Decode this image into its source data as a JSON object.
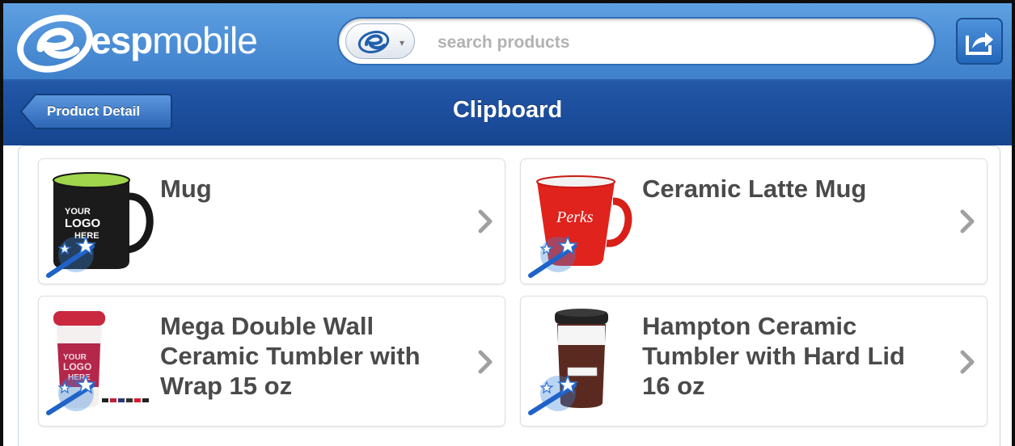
{
  "header": {
    "logo_text_bold": "esp",
    "logo_text_light": "mobile",
    "search": {
      "placeholder": "search products",
      "value": ""
    }
  },
  "subheader": {
    "back_label": "Product Detail",
    "title": "Clipboard"
  },
  "products": [
    {
      "name": "Mug",
      "image": "black-mug-with-green-interior"
    },
    {
      "name": "Ceramic Latte Mug",
      "image": "red-latte-mug"
    },
    {
      "name": "Mega Double Wall Ceramic Tumbler with Wrap 15 oz",
      "image": "red-ceramic-tumbler-with-wrap"
    },
    {
      "name": "Hampton Ceramic Tumbler with Hard Lid 16 oz",
      "image": "brown-ceramic-tumbler-with-black-lid"
    }
  ],
  "thumbnail_texts": {
    "mug_imprint": "YOUR LOGO HERE",
    "latte_imprint": "Perks",
    "tumbler_imprint": "YOUR LOGO HERE"
  },
  "icons": [
    "esp-logo-icon",
    "search-e-icon",
    "share-icon",
    "back-arrow-icon",
    "chevron-right-icon",
    "magic-wand-icon"
  ],
  "colors": {
    "header_blue": "#4d8fd6",
    "subheader_blue": "#1a4c9a",
    "text_gray": "#4a4a4a",
    "chevron_gray": "#a0a0a0"
  }
}
